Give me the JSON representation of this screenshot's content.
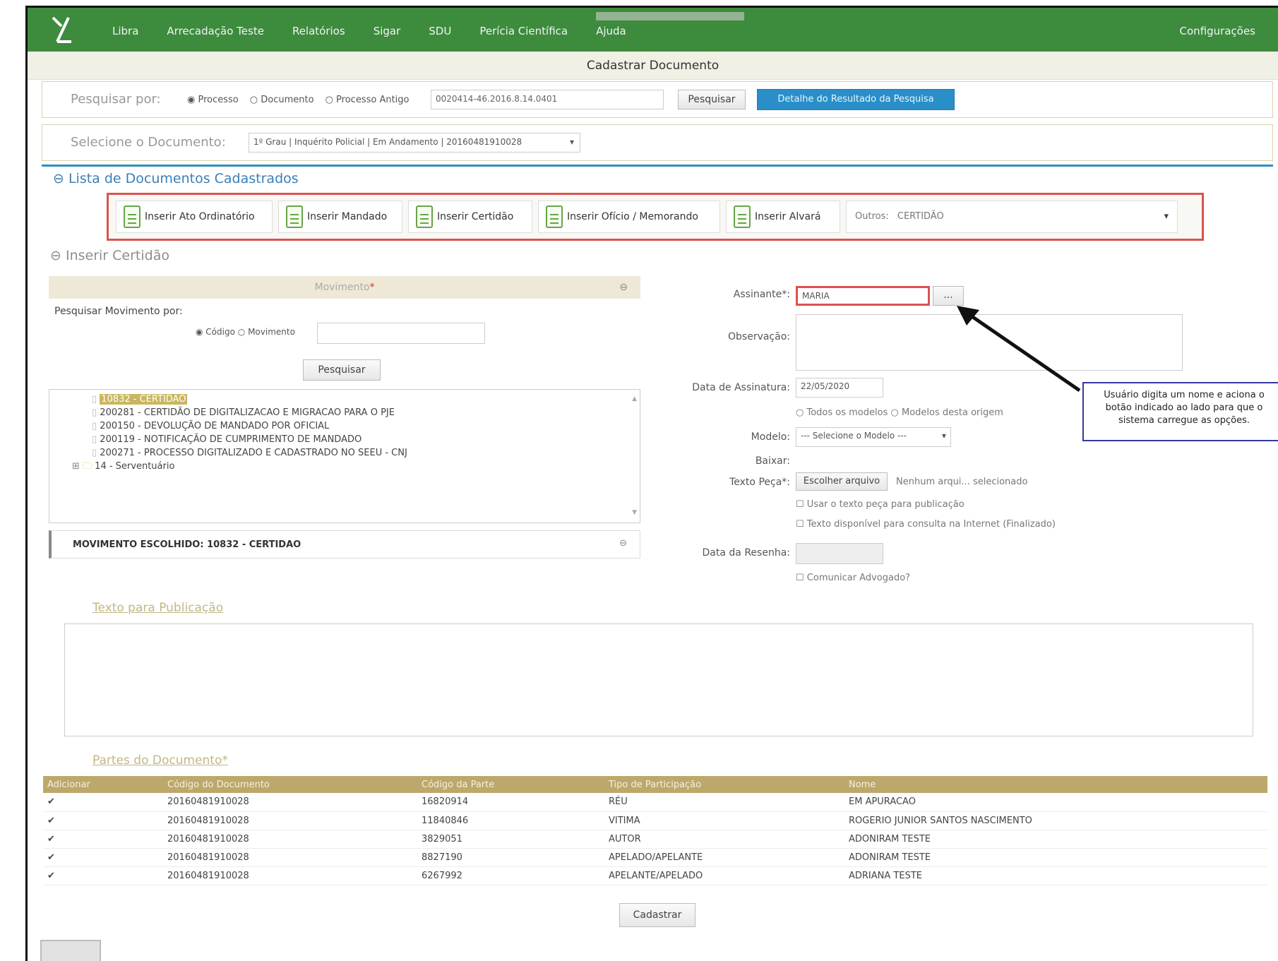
{
  "nav": {
    "items": [
      "Libra",
      "Arrecadação Teste",
      "Relatórios",
      "Sigar",
      "SDU",
      "Perícia Científica",
      "Ajuda"
    ],
    "config": "Configurações"
  },
  "page": {
    "title": "Cadastrar Documento"
  },
  "search": {
    "label": "Pesquisar por:",
    "options": [
      "Processo",
      "Documento",
      "Processo Antigo"
    ],
    "value": "0020414-46.2016.8.14.0401",
    "search_button": "Pesquisar",
    "detail_button": "Detalhe do Resultado da Pesquisa"
  },
  "select_doc": {
    "label": "Selecione o Documento:",
    "value": "1º Grau | Inquérito Policial | Em Andamento | 20160481910028"
  },
  "list": {
    "title": "Lista de Documentos Cadastrados"
  },
  "insert_buttons": [
    "Inserir Ato Ordinatório",
    "Inserir Mandado",
    "Inserir Certidão",
    "Inserir Ofício / Memorando",
    "Inserir Alvará"
  ],
  "outros": {
    "label": "Outros:",
    "value": "CERTIDÃO"
  },
  "insert_title": "Inserir Certidão",
  "movimento": {
    "header": "Movimento",
    "search_label": "Pesquisar Movimento por:",
    "options": [
      "Código",
      "Movimento"
    ],
    "search_button": "Pesquisar",
    "tree": [
      "10832 - CERTIDÃO",
      "200281 - CERTIDÃO DE DIGITALIZACAO E MIGRACAO PARA O PJE",
      "200150 - DEVOLUÇÃO DE MANDADO POR OFICIAL",
      "200119 - NOTIFICAÇÃO DE CUMPRIMENTO DE MANDADO",
      "200271 - PROCESSO DIGITALIZADO E CADASTRADO NO SEEU - CNJ",
      "14 - Serventuário"
    ],
    "chosen": "MOVIMENTO ESCOLHIDO: 10832 - CERTIDAO"
  },
  "form": {
    "assinante_label": "Assinante*:",
    "assinante_value": "MARIA",
    "assinante_button": "...",
    "observacao_label": "Observação:",
    "data_assinatura_label": "Data de Assinatura:",
    "data_assinatura_value": "22/05/2020",
    "modelos_options": [
      "Todos os modelos",
      "Modelos desta origem"
    ],
    "modelo_label": "Modelo:",
    "modelo_value": "--- Selecione o Modelo ---",
    "baixar_label": "Baixar:",
    "texto_peca_label": "Texto Peça*:",
    "file_button": "Escolher arquivo",
    "file_status": "Nenhum arqui... selecionado",
    "check1": "Usar o texto peça para publicação",
    "check2": "Texto disponível para consulta na Internet (Finalizado)",
    "data_resenha_label": "Data da Resenha:",
    "check3": "Comunicar Advogado?"
  },
  "callout": "Usuário digita um nome e aciona o botão indicado ao lado para que o sistema carregue as opções.",
  "publicacao": {
    "title": "Texto para Publicação"
  },
  "partes": {
    "title": "Partes do Documento*",
    "headers": [
      "Adicionar",
      "Código do Documento",
      "Código da Parte",
      "Tipo de Participação",
      "Nome"
    ],
    "rows": [
      [
        "✔",
        "20160481910028",
        "16820914",
        "RÉU",
        "EM APURACAO"
      ],
      [
        "✔",
        "20160481910028",
        "11840846",
        "VITIMA",
        "ROGERIO JUNIOR SANTOS NASCIMENTO"
      ],
      [
        "✔",
        "20160481910028",
        "3829051",
        "AUTOR",
        "ADONIRAM TESTE"
      ],
      [
        "✔",
        "20160481910028",
        "8827190",
        "APELADO/APELANTE",
        "ADONIRAM TESTE"
      ],
      [
        "✔",
        "20160481910028",
        "6267992",
        "APELANTE/APELADO",
        "ADRIANA TESTE"
      ]
    ]
  },
  "submit": "Cadastrar"
}
